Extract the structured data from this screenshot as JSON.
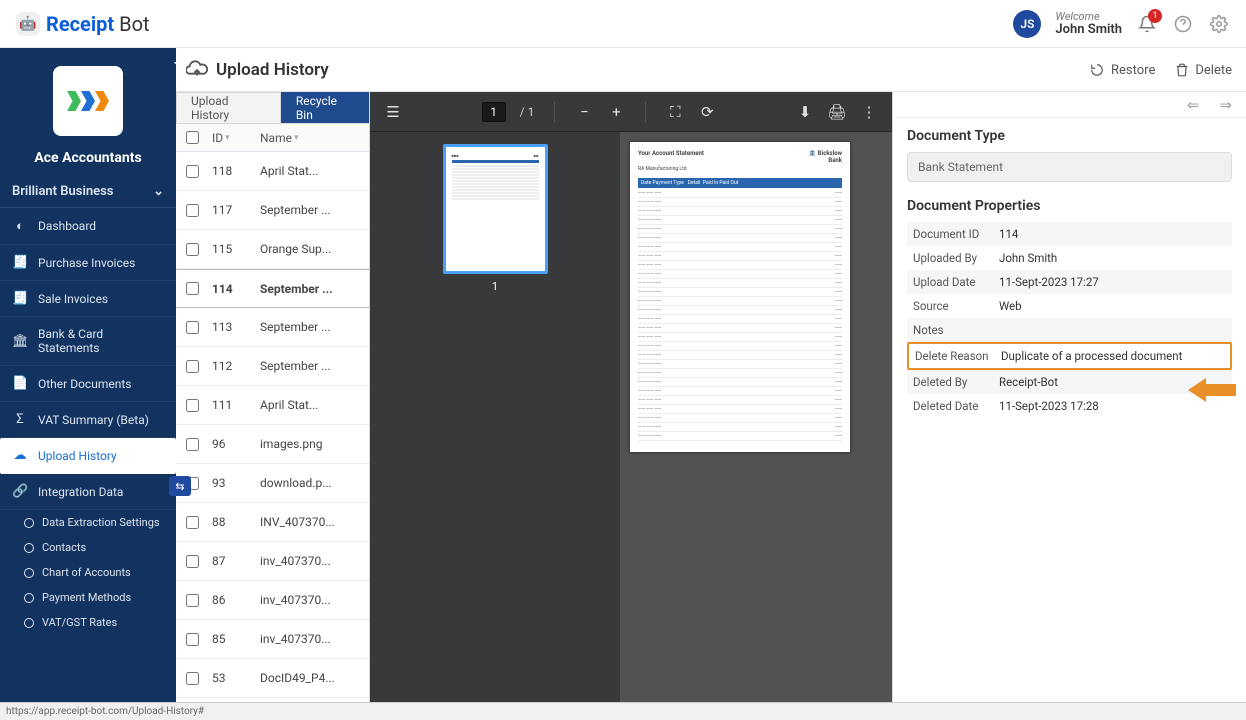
{
  "brand": {
    "bold": "Receipt",
    "light": "Bot"
  },
  "header": {
    "welcome": "Welcome",
    "username": "John Smith",
    "initials": "JS",
    "notifCount": "1"
  },
  "sidebar": {
    "clientName": "Ace Accountants",
    "businessLabel": "Brilliant Business",
    "items": [
      "Dashboard",
      "Purchase Invoices",
      "Sale Invoices",
      "Bank & Card Statements",
      "Other Documents",
      "VAT Summary (Beta)",
      "Upload History",
      "Integration Data"
    ],
    "subs": [
      "Data Extraction Settings",
      "Contacts",
      "Chart of Accounts",
      "Payment Methods",
      "VAT/GST Rates"
    ]
  },
  "page": {
    "title": "Upload History",
    "tabs": {
      "history": "Upload History",
      "recycle": "Recycle Bin"
    },
    "actions": {
      "restore": "Restore",
      "delete": "Delete"
    }
  },
  "table": {
    "cols": {
      "id": "ID",
      "name": "Name"
    },
    "rows": [
      {
        "id": "118",
        "name": "April Stat..."
      },
      {
        "id": "117",
        "name": "September ..."
      },
      {
        "id": "115",
        "name": "Orange Sup..."
      },
      {
        "id": "114",
        "name": "September ..."
      },
      {
        "id": "113",
        "name": "September ..."
      },
      {
        "id": "112",
        "name": "September ..."
      },
      {
        "id": "111",
        "name": "April Stat..."
      },
      {
        "id": "96",
        "name": "images.png"
      },
      {
        "id": "93",
        "name": "download.p..."
      },
      {
        "id": "88",
        "name": "INV_407370..."
      },
      {
        "id": "87",
        "name": "inv_407370..."
      },
      {
        "id": "86",
        "name": "inv_407370..."
      },
      {
        "id": "85",
        "name": "inv_407370..."
      },
      {
        "id": "53",
        "name": "DocID49_P4..."
      }
    ]
  },
  "viewer": {
    "page": "1",
    "total": "/ 1",
    "thumbNum": "1"
  },
  "infopanel": {},
  "docType": {
    "title": "Document Type",
    "value": "Bank Statement"
  },
  "props": {
    "title": "Document Properties",
    "rows": [
      {
        "label": "Document ID",
        "value": "114"
      },
      {
        "label": "Uploaded By",
        "value": "John Smith"
      },
      {
        "label": "Upload Date",
        "value": "11-Sept-2023 17:27"
      },
      {
        "label": "Source",
        "value": "Web"
      },
      {
        "label": "Notes",
        "value": ""
      },
      {
        "label": "Delete Reason",
        "value": "Duplicate of a processed document"
      },
      {
        "label": "Deleted By",
        "value": "Receipt-Bot"
      },
      {
        "label": "Deleted Date",
        "value": "11-Sept-2023 17:28"
      }
    ]
  },
  "status": {
    "url": "https://app.receipt-bot.com/Upload-History#"
  }
}
